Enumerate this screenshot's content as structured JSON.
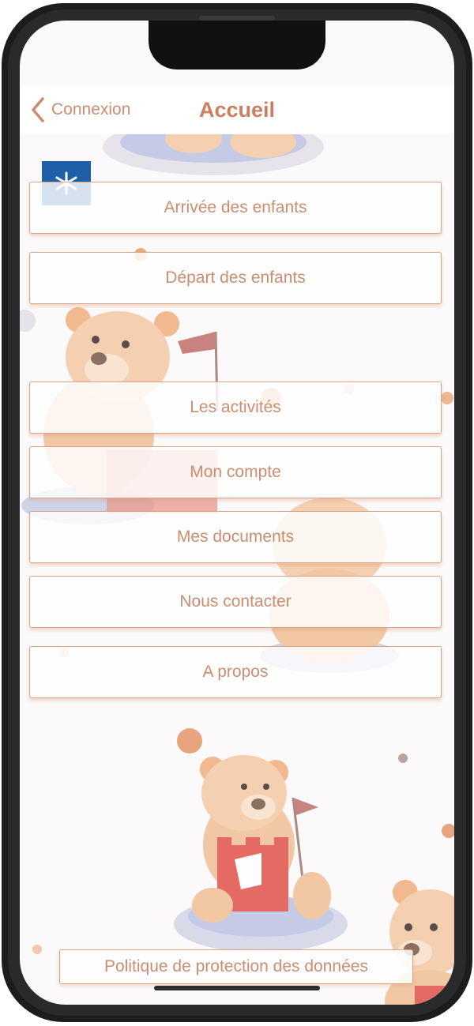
{
  "nav": {
    "back_label": "Connexion",
    "title": "Accueil"
  },
  "menu": [
    {
      "label": "Arrivée des enfants"
    },
    {
      "label": "Départ des enfants"
    },
    {
      "label": "Les activités"
    },
    {
      "label": "Mon compte"
    },
    {
      "label": "Mes documents"
    },
    {
      "label": "Nous contacter"
    },
    {
      "label": "A propos"
    }
  ],
  "footer": {
    "privacy_label": "Politique de protection des données"
  },
  "colors": {
    "accent": "#c98e72",
    "title": "#c9805f",
    "border": "#d8a589",
    "background": "#fbf9f9",
    "logo": "#1f5fa8"
  },
  "icons": {
    "back": "chevron-left-icon",
    "logo": "snowflake-logo-icon"
  }
}
